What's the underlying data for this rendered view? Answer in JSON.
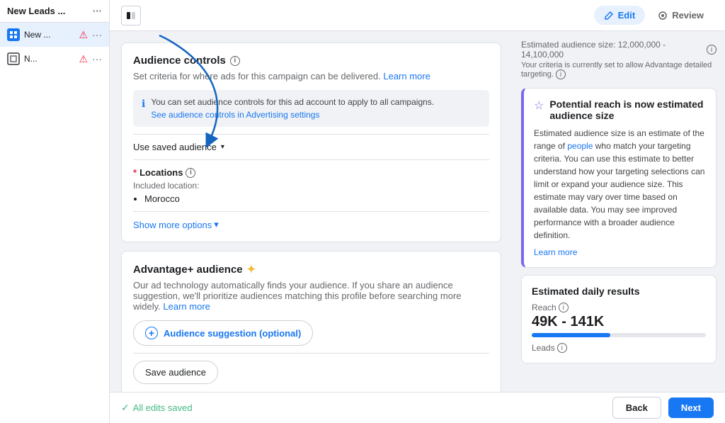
{
  "sidebar": {
    "header_label": "New Leads ...",
    "items": [
      {
        "id": "new-1",
        "label": "New ...",
        "type": "filled",
        "warning": true,
        "more": true
      },
      {
        "id": "new-2",
        "label": "N...",
        "type": "outline",
        "warning": true,
        "more": true
      }
    ]
  },
  "topbar": {
    "collapse_title": "collapse sidebar",
    "tabs": [
      {
        "id": "edit",
        "label": "Edit",
        "active": true
      },
      {
        "id": "review",
        "label": "Review",
        "active": false
      }
    ]
  },
  "audience_controls": {
    "title": "Audience controls",
    "subtitle": "Set criteria for where ads for this campaign can be delivered.",
    "learn_more": "Learn more",
    "info_banner": "You can set audience controls for this ad account to apply to all campaigns.",
    "ad_settings_link": "See audience controls in Advertising settings",
    "use_saved_audience": "Use saved audience",
    "locations": {
      "label": "Locations",
      "required": true,
      "included_label": "Included location:",
      "location_item": "Morocco"
    },
    "show_more_options": "Show more options"
  },
  "advantage_audience": {
    "title": "Advantage+ audience",
    "subtitle": "Our ad technology automatically finds your audience. If you share an audience suggestion, we'll prioritize audiences matching this profile before searching more widely.",
    "learn_more": "Learn more",
    "suggestion_btn": "Audience suggestion (optional)",
    "save_btn": "Save audience"
  },
  "right_panel": {
    "est_size_label": "Estimated audience size: 12,000,000 - 14,100,000",
    "est_size_note": "Your criteria is currently set to allow Advantage detailed targeting.",
    "potential_reach": {
      "title": "Potential reach is now estimated audience size",
      "body": "Estimated audience size is an estimate of the range of people who match your targeting criteria. You can use this estimate to better understand how your targeting selections can limit or expand your audience size. This estimate may vary over time based on available data. You may see improved performance with a broader audience definition.",
      "learn_more": "Learn more",
      "people_text": "people"
    },
    "estimated_daily": {
      "title": "Estimated daily results",
      "reach_label": "Reach",
      "reach_value": "49K - 141K",
      "leads_label": "Leads"
    }
  },
  "footer": {
    "saved_text": "All edits saved",
    "back_label": "Back",
    "next_label": "Next"
  }
}
